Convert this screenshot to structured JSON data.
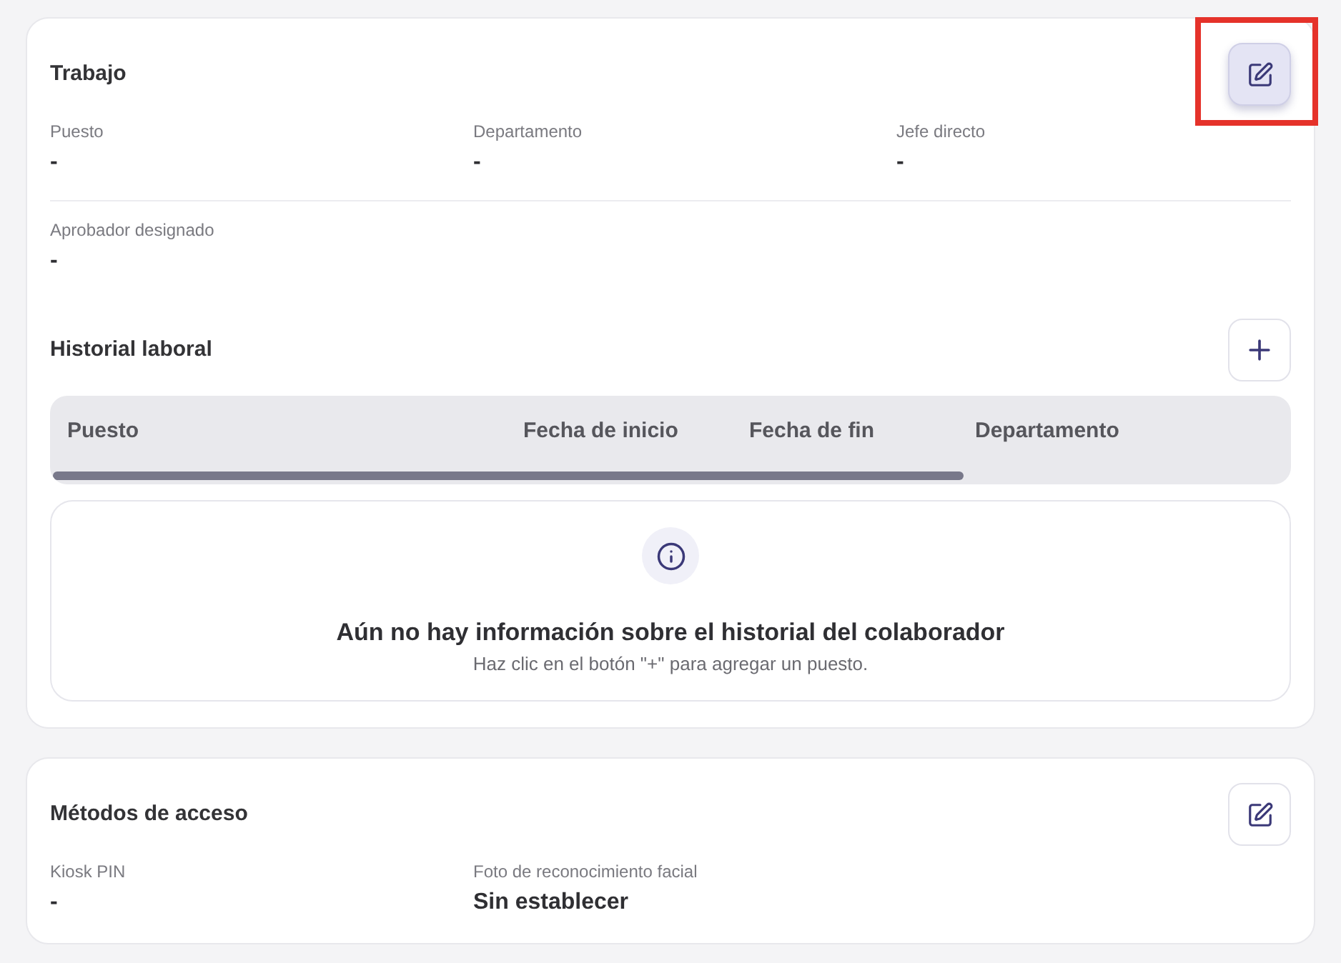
{
  "sections": [
    {
      "title": "Trabajo",
      "edit_button": {
        "hovered": true,
        "highlighted": true
      },
      "field_rows": [
        [
          {
            "label": "Puesto",
            "value": "-"
          },
          {
            "label": "Departamento",
            "value": "-"
          },
          {
            "label": "Jefe directo",
            "value": "-"
          }
        ],
        [
          {
            "label": "Aprobador designado",
            "value": "-"
          }
        ]
      ],
      "history": {
        "title": "Historial laboral",
        "columns": [
          "Puesto",
          "Fecha de inicio",
          "Fecha de fin",
          "Departamento"
        ],
        "empty_state": {
          "title": "Aún no hay información sobre el historial del colaborador",
          "message": "Haz clic en el botón \"+\" para agregar un puesto."
        }
      }
    },
    {
      "title": "Métodos de acceso",
      "edit_button": {
        "hovered": false,
        "highlighted": false
      },
      "field_rows": [
        [
          {
            "label": "Kiosk PIN",
            "value": "-"
          },
          {
            "label": "Foto de reconocimiento facial",
            "value": "Sin establecer"
          }
        ]
      ]
    }
  ]
}
